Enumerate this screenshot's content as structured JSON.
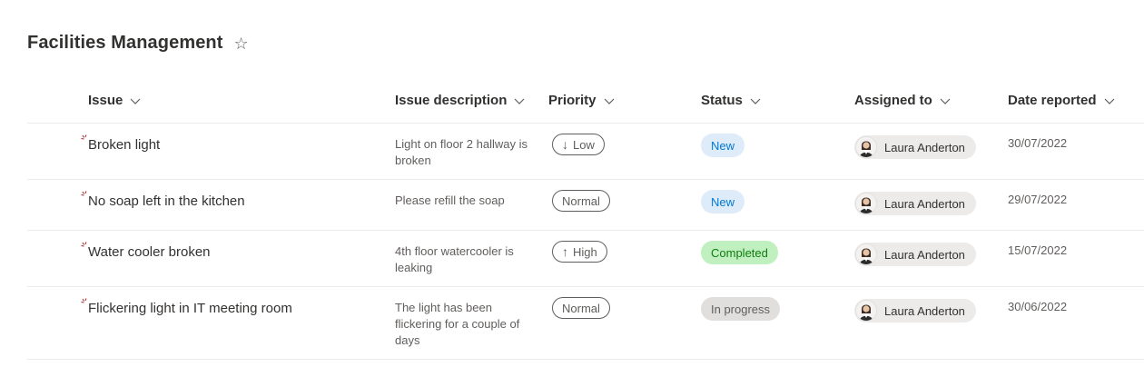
{
  "page": {
    "title": "Facilities Management"
  },
  "columns": [
    {
      "label": "Issue"
    },
    {
      "label": "Issue description"
    },
    {
      "label": "Priority"
    },
    {
      "label": "Status"
    },
    {
      "label": "Assigned to"
    },
    {
      "label": "Date reported"
    }
  ],
  "rows": [
    {
      "issue": "Broken light",
      "description": "Light on floor 2 hallway is broken",
      "priority": {
        "label": "Low",
        "arrow": "↓"
      },
      "status": {
        "label": "New",
        "bg": "#deecf9",
        "fg": "#0078d4"
      },
      "assigned": "Laura Anderton",
      "date": "30/07/2022"
    },
    {
      "issue": "No soap left in the kitchen",
      "description": "Please refill the soap",
      "priority": {
        "label": "Normal",
        "arrow": ""
      },
      "status": {
        "label": "New",
        "bg": "#deecf9",
        "fg": "#0078d4"
      },
      "assigned": "Laura Anderton",
      "date": "29/07/2022"
    },
    {
      "issue": "Water cooler broken",
      "description": "4th floor watercooler is leaking",
      "priority": {
        "label": "High",
        "arrow": "↑"
      },
      "status": {
        "label": "Completed",
        "bg": "#c1f0c0",
        "fg": "#107c10"
      },
      "assigned": "Laura Anderton",
      "date": "15/07/2022"
    },
    {
      "issue": "Flickering light in IT meeting room",
      "description": "The light has been flickering for a couple of days",
      "priority": {
        "label": "Normal",
        "arrow": ""
      },
      "status": {
        "label": "In progress",
        "bg": "#e1dfdd",
        "fg": "#605e5c"
      },
      "assigned": "Laura Anderton",
      "date": "30/06/2022"
    }
  ],
  "colors": {
    "new_indicator": "#a4262c",
    "border": "#edebe9"
  }
}
